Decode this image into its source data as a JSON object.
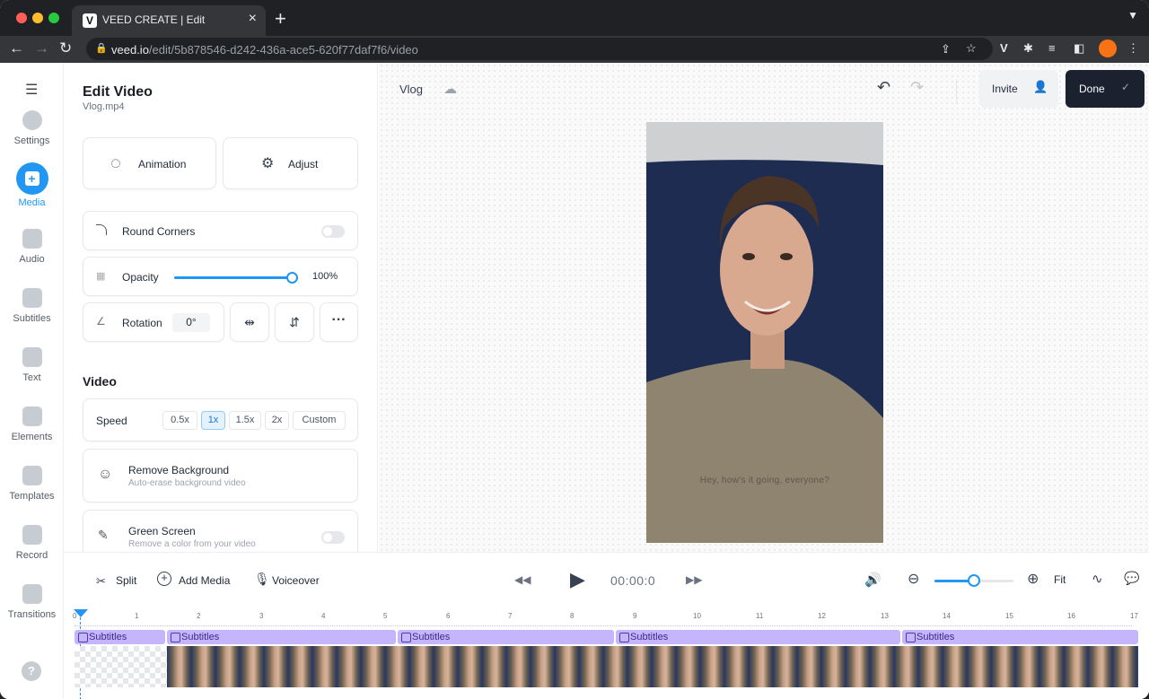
{
  "browser": {
    "tab_title": "VEED CREATE | Edit",
    "tab_favicon": "V",
    "url_host": "veed.io",
    "url_path": "/edit/5b878546-d242-436a-ace5-620f77daf7f6/video"
  },
  "sidebar": {
    "items": [
      {
        "label": "Settings",
        "icon": "gear-icon"
      },
      {
        "label": "Media",
        "icon": "plus-icon",
        "active": true
      },
      {
        "label": "Audio",
        "icon": "music-note-icon"
      },
      {
        "label": "Subtitles",
        "icon": "subtitles-icon"
      },
      {
        "label": "Text",
        "icon": "text-icon"
      },
      {
        "label": "Elements",
        "icon": "elements-icon"
      },
      {
        "label": "Templates",
        "icon": "templates-icon"
      },
      {
        "label": "Record",
        "icon": "record-icon"
      },
      {
        "label": "Transitions",
        "icon": "transitions-icon"
      }
    ]
  },
  "panel": {
    "title": "Edit Video",
    "filename": "Vlog.mp4",
    "animation_label": "Animation",
    "adjust_label": "Adjust",
    "round_corners_label": "Round Corners",
    "opacity_label": "Opacity",
    "opacity_value": "100%",
    "opacity_level": 1.0,
    "rotation_label": "Rotation",
    "rotation_value": "0°",
    "video_section": "Video",
    "speed_label": "Speed",
    "speed_options": [
      "0.5x",
      "1x",
      "1.5x",
      "2x",
      "Custom"
    ],
    "speed_selected": "1x",
    "remove_bg_title": "Remove Background",
    "remove_bg_sub": "Auto-erase background video",
    "green_screen_title": "Green Screen",
    "green_screen_sub": "Remove a color from your video"
  },
  "header": {
    "project_name": "Vlog",
    "invite_label": "Invite",
    "done_label": "Done"
  },
  "preview": {
    "caption": "Hey, how's it going, everyone?"
  },
  "timeline": {
    "split_label": "Split",
    "add_media_label": "Add Media",
    "voiceover_label": "Voiceover",
    "timecode": "00:00:0",
    "fit_label": "Fit",
    "zoom_level": 0.5,
    "ruler_ticks": [
      "0",
      "1",
      "2",
      "3",
      "4",
      "5",
      "6",
      "7",
      "8",
      "9",
      "10",
      "11",
      "12",
      "13",
      "14",
      "15",
      "16",
      "17"
    ],
    "subtitle_tracks": [
      "Subtitles",
      "Subtitles",
      "Subtitles",
      "Subtitles",
      "Subtitles"
    ]
  },
  "colors": {
    "accent": "#2196f3",
    "done_bg": "#1c2130",
    "subtitle_track": "#c4b5fd"
  }
}
